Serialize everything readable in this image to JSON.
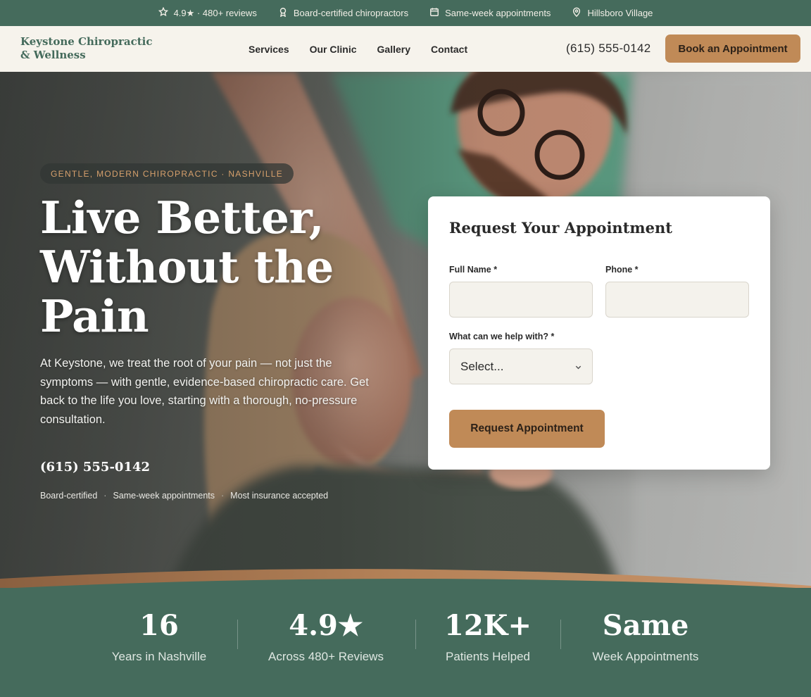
{
  "topbar": {
    "items": [
      {
        "icon": "star-icon",
        "text": "4.9★ · 480+ reviews"
      },
      {
        "icon": "award-icon",
        "text": "Board-certified chiropractors"
      },
      {
        "icon": "calendar-icon",
        "text": "Same-week appointments"
      },
      {
        "icon": "map-pin-icon",
        "text": "Hillsboro Village"
      }
    ]
  },
  "header": {
    "logo_line1": "Keystone Chiropractic",
    "logo_line2": "& Wellness",
    "nav": [
      "Services",
      "Our Clinic",
      "Gallery",
      "Contact"
    ],
    "phone": "(615) 555-0142",
    "cta": "Book an Appointment"
  },
  "hero": {
    "eyebrow": "GENTLE, MODERN CHIROPRACTIC · NASHVILLE",
    "title": "Live Better, Without the Pain",
    "subtitle": "At Keystone, we treat the root of your pain — not just the symptoms — with gentle, evidence-based chiropractic care. Get back to the life you love, starting with a thorough, no-pressure consultation.",
    "phone": "(615) 555-0142",
    "trust": [
      "Board-certified",
      "Same-week appointments",
      "Most insurance accepted"
    ],
    "trust_separator": "·"
  },
  "form": {
    "title": "Request Your Appointment",
    "name_label": "Full Name *",
    "name_value": "",
    "phone_label": "Phone *",
    "phone_value": "",
    "help_label": "What can we help with? *",
    "help_selected": "Select...",
    "submit": "Request Appointment"
  },
  "stats": [
    {
      "value": "16",
      "label": "Years in Nashville"
    },
    {
      "value": "4.9★",
      "label": "Across 480+ Reviews"
    },
    {
      "value": "12K+",
      "label": "Patients Helped"
    },
    {
      "value": "Same",
      "label": "Week Appointments"
    }
  ],
  "colors": {
    "brand_green": "#456b5c",
    "accent_tan": "#c08a57",
    "cream": "#f6f3ec"
  }
}
